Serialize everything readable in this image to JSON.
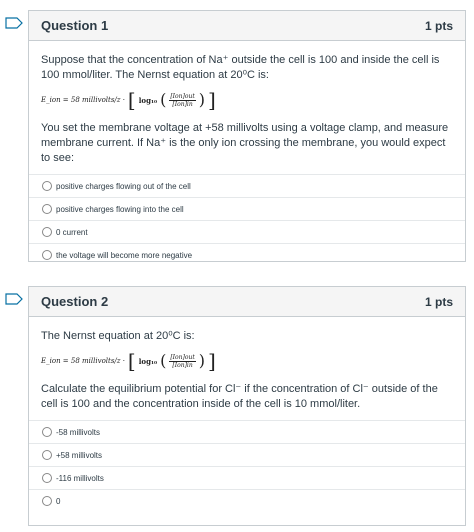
{
  "questions": [
    {
      "title": "Question 1",
      "points": "1 pts",
      "paragraphs": [
        "Suppose that the concentration of Na⁺ outside the cell is 100 and inside the cell is 100 mmol/liter. The Nernst equation at 20⁰C is:",
        "You set the membrane voltage at +58 millivolts using a voltage clamp, and measure membrane current. If Na⁺ is the only ion crossing the membrane, you would expect to see:"
      ],
      "equation": {
        "lhs": "E_ion = 58 millivolts/z ·",
        "log": "log₁₀",
        "num": "[Ion]out",
        "den": "[Ion]in"
      },
      "answers": [
        "positive charges flowing out of the cell",
        "positive charges flowing into the cell",
        "0 current",
        "the voltage will become more negative"
      ]
    },
    {
      "title": "Question 2",
      "points": "1 pts",
      "paragraphs": [
        "The Nernst equation at 20⁰C is:",
        "Calculate the equilibrium potential for Cl⁻ if the concentration of Cl⁻ outside of the cell is 100 and the concentration inside of the cell is 10 mmol/liter."
      ],
      "equation": {
        "lhs": "E_ion = 58 millivolts/z ·",
        "log": "log₁₀",
        "num": "[Ion]out",
        "den": "[Ion]in"
      },
      "answers": [
        "-58 millivolts",
        "+58 millivolts",
        "-116 millivolts",
        "0"
      ]
    }
  ]
}
